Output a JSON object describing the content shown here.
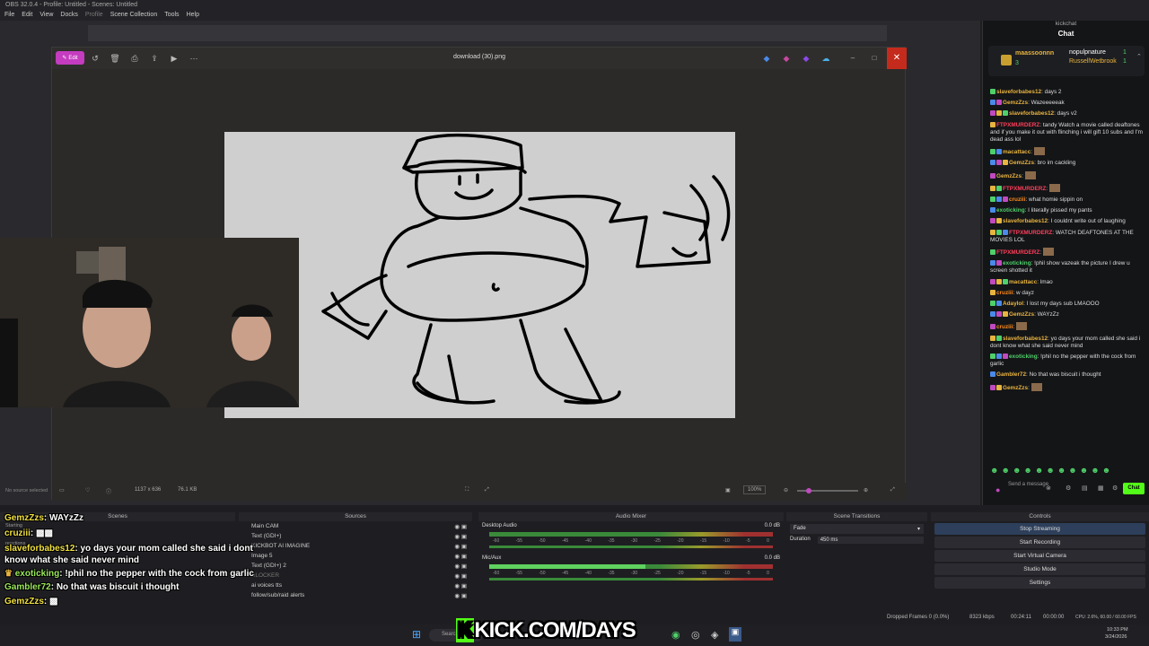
{
  "obs": {
    "title": "OBS 32.0.4 - Profile: Untitled - Scenes: Untitled",
    "menu": [
      "File",
      "Edit",
      "View",
      "Docks",
      "Profile",
      "Scene Collection",
      "Tools",
      "Help"
    ]
  },
  "viewer": {
    "edit_label": "Edit",
    "filename": "download (30).png",
    "dimensions": "1137 x 636",
    "filesize": "76.1 KB",
    "zoom": "100%"
  },
  "status": {
    "no_source": "No source selected",
    "dropped_frames": "Dropped Frames 0 (0.0%)",
    "kbps": "8323 kbps",
    "time": "00:24:11",
    "rec_time": "00:00:00",
    "cpu": "CPU: 2.6%, 60.00 / 60.00 FPS",
    "clock": "10:33 PM",
    "date": "3/24/2026"
  },
  "docks": {
    "scenes": {
      "title": "Scenes",
      "items": [
        "Starting",
        "reactions"
      ]
    },
    "sources": {
      "title": "Sources",
      "items": [
        "Main CAM",
        "Text (GDI+)",
        "KICKBOT AI IMAGINE",
        "Image 5",
        "Text (GDI+) 2",
        "BLOCKER",
        "ai voices tts",
        "follow/sub/raid alerts"
      ]
    },
    "audio": {
      "title": "Audio Mixer",
      "channels": [
        {
          "name": "Desktop Audio",
          "db": "0.0 dB",
          "level": 0.0
        },
        {
          "name": "Mic/Aux",
          "db": "0.0 dB",
          "level": 0.55
        }
      ],
      "ticks": [
        "-60",
        "-55",
        "-50",
        "-45",
        "-40",
        "-35",
        "-30",
        "-25",
        "-20",
        "-15",
        "-10",
        "-5",
        "0"
      ]
    },
    "transitions": {
      "title": "Scene Transitions",
      "type": "Fade",
      "duration_label": "Duration",
      "duration": "450 ms"
    },
    "controls": {
      "title": "Controls",
      "buttons": [
        "Stop Streaming",
        "Start Recording",
        "Start Virtual Camera",
        "Studio Mode",
        "Settings"
      ]
    }
  },
  "overlay_chat": [
    {
      "user": "GemzZzs",
      "text": "WAYzZz"
    },
    {
      "user": "cruziii",
      "text": ""
    },
    {
      "user": "slaveforbabes12",
      "text": "yo days your mom called she said i dont know what she said never mind"
    },
    {
      "user": "exoticking",
      "text": "!phil no the pepper with the cock from garlic"
    },
    {
      "user": "Gambler72",
      "text": "No that was biscuit i thought"
    },
    {
      "user": "GemzZzs",
      "text": ""
    }
  ],
  "kick_banner": {
    "k": "K",
    "text": "KICK.COM/DAYS"
  },
  "chat": {
    "window_title": "kickchat",
    "header": "Chat",
    "pinned": [
      {
        "user": "maassoonnn",
        "count": "3"
      },
      {
        "user": "nopulpnature",
        "count": "1"
      },
      {
        "user": "RussellWetbrook",
        "count": "1"
      }
    ],
    "messages": [
      {
        "user": "slaveforbabes12",
        "color": "y",
        "text": "days 2"
      },
      {
        "user": "GemzZzs",
        "color": "y",
        "text": "Wazeeeeeak"
      },
      {
        "user": "slaveforbabes12",
        "color": "y",
        "text": "days v2"
      },
      {
        "user": "FTPXMURDERZ",
        "color": "r",
        "text": "tandy Watch a movie called deaftones and if you make it out with flinching i will gift 10 subs and I'm dead ass lol"
      },
      {
        "user": "macattacc",
        "color": "y",
        "text": ""
      },
      {
        "user": "GemzZzs",
        "color": "y",
        "text": "bro im cackling"
      },
      {
        "user": "GemzZzs",
        "color": "y",
        "text": ""
      },
      {
        "user": "FTPXMURDERZ",
        "color": "r",
        "text": ""
      },
      {
        "user": "cruziii",
        "color": "o",
        "text": "what homie sippin on"
      },
      {
        "user": "exoticking",
        "color": "g",
        "text": "I literally pissed my pants"
      },
      {
        "user": "slaveforbabes12",
        "color": "y",
        "text": "I couldnt write out of laughing"
      },
      {
        "user": "FTPXMURDERZ",
        "color": "r",
        "text": "WATCH DEAFTONES AT THE MOVIES LOL"
      },
      {
        "user": "FTPXMURDERZ",
        "color": "r",
        "text": ""
      },
      {
        "user": "exoticking",
        "color": "g",
        "text": "!phil show vazeak the picture I drew u screen shotted it"
      },
      {
        "user": "macattacc",
        "color": "y",
        "text": "lmao"
      },
      {
        "user": "cruziii",
        "color": "o",
        "text": "w dayz"
      },
      {
        "user": "Adaylol",
        "color": "y",
        "text": "I lost my days sub LMAOOO"
      },
      {
        "user": "GemzZzs",
        "color": "y",
        "text": "WAYzZz"
      },
      {
        "user": "cruziii",
        "color": "o",
        "text": ""
      },
      {
        "user": "slaveforbabes12",
        "color": "y",
        "text": "yo days your mom called she said i dont know what she said never mind"
      },
      {
        "user": "exoticking",
        "color": "g",
        "text": "!phil no the pepper with the cock from garlic"
      },
      {
        "user": "Gambler72",
        "color": "y",
        "text": "No that was biscuit i thought"
      },
      {
        "user": "GemzZzs",
        "color": "y",
        "text": ""
      }
    ],
    "input_placeholder": "Send a message",
    "send_label": "Chat"
  },
  "taskbar": {
    "search": "Search"
  },
  "colors": {
    "edit": "#c43cc0",
    "close": "#c42b1c",
    "kick_green": "#53fc18",
    "chat_bg": "#141517"
  }
}
